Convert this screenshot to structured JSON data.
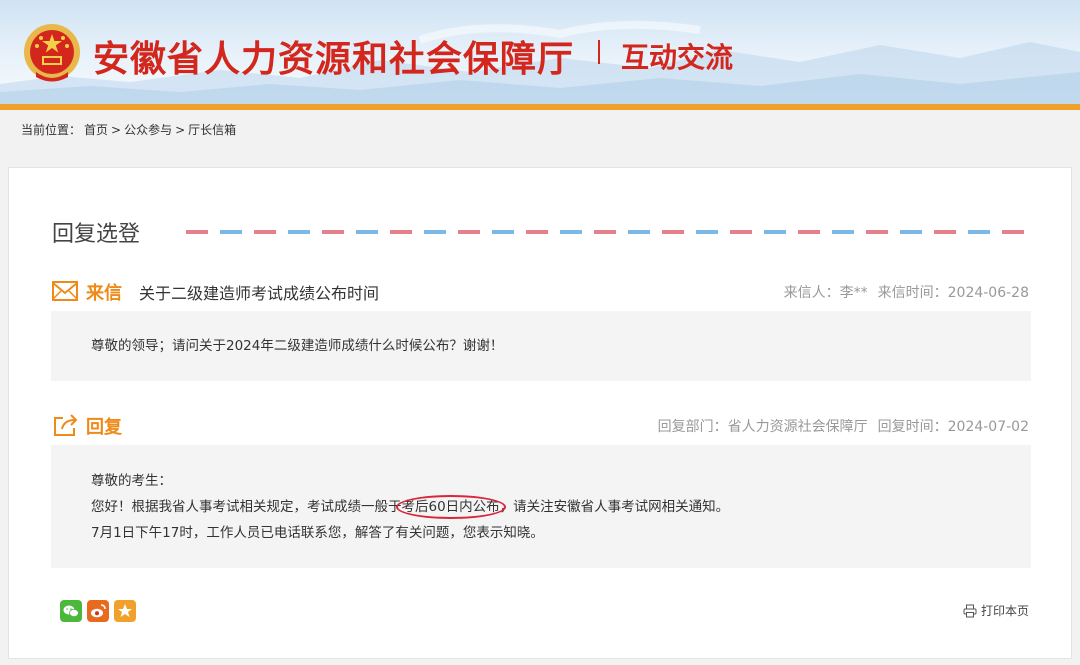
{
  "header": {
    "site_title": "安徽省人力资源和社会保障厅",
    "site_subtitle": "互动交流"
  },
  "breadcrumb": {
    "prefix": "当前位置：",
    "items": [
      "首页",
      "公众参与",
      "厅长信箱"
    ],
    "separator": ">"
  },
  "section": {
    "title": "回复选登"
  },
  "letter": {
    "label": "来信",
    "subject": "关于二级建造师考试成绩公布时间",
    "sender_label": "来信人：",
    "sender": "李**",
    "time_label": "来信时间：",
    "time": "2024-06-28",
    "content": "尊敬的领导；请问关于2024年二级建造师成绩什么时候公布？谢谢！"
  },
  "reply": {
    "label": "回复",
    "dept_label": "回复部门：",
    "dept": "省人力资源社会保障厅",
    "time_label": "回复时间：",
    "time": "2024-07-02",
    "greeting": "尊敬的考生：",
    "line1_before": "您好！根据我省人事考试相关规定，考试成绩一般于",
    "line1_highlight": "考后60日内公布",
    "line1_after": "，请关注安徽省人事考试网相关通知。",
    "line2": "7月1日下午17时，工作人员已电话联系您，解答了有关问题，您表示知晓。"
  },
  "footer": {
    "print_label": "打印本页",
    "share_icons": [
      "wechat-icon",
      "weibo-icon",
      "favorite-icon"
    ]
  },
  "colors": {
    "brand_red": "#d3261c",
    "accent_orange": "#ef8a18",
    "highlight_circle": "#d8263b"
  }
}
